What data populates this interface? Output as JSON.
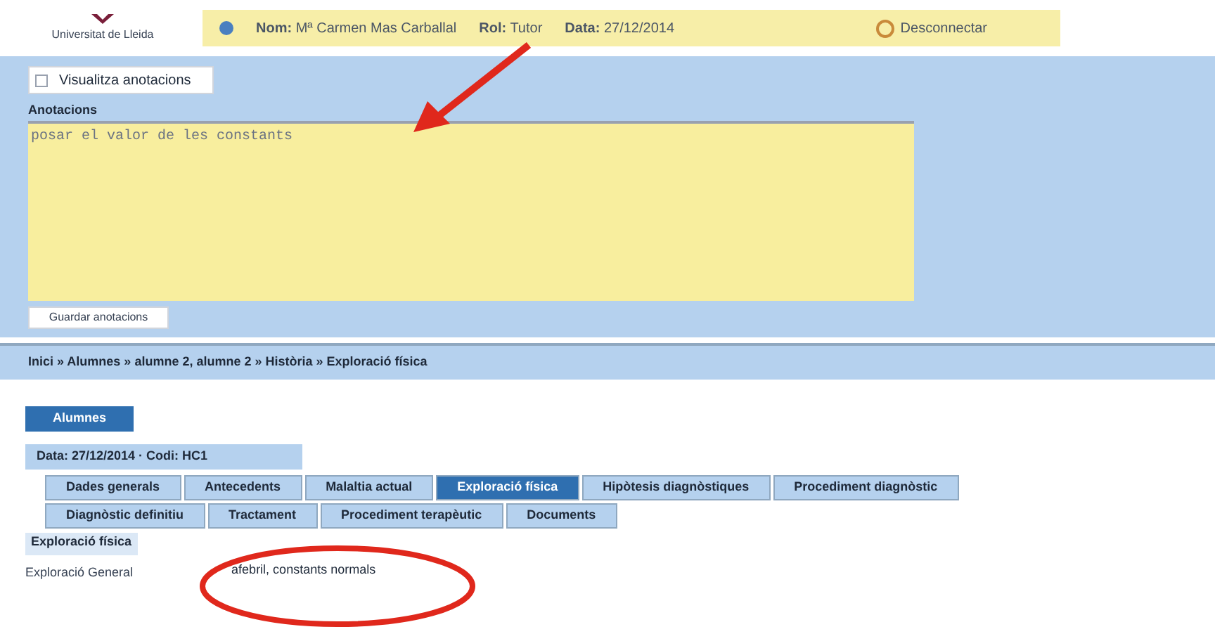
{
  "header": {
    "logo_text": "Universitat de Lleida",
    "user": "**Nom:** Mª Carmen Mas Carballal",
    "role": "**Rol:** Tutor",
    "date": "**Data:** 27/12/2014",
    "logout": "Desconnectar"
  },
  "annotations": {
    "toggle_button": "Visualitza anotacions",
    "checked": false,
    "label": "Anotacions",
    "text": "posar el valor de les constants",
    "save_button": "Guardar anotacions"
  },
  "breadcrumb": "Inici » Alumnes » alumne 2, alumne 2 » Història » Exploració física",
  "back_button": "Alumnes",
  "record_info": "Data: 27/12/2014 · Codi: HC1",
  "tabs": [
    [
      {
        "label": "Dades generals",
        "selected": false
      },
      {
        "label": "Antecedents",
        "selected": false
      },
      {
        "label": "Malaltia actual",
        "selected": false
      },
      {
        "label": "Exploració física",
        "selected": true
      },
      {
        "label": "Hipòtesis diagnòstiques",
        "selected": false
      },
      {
        "label": "Procediment diagnòstic",
        "selected": false
      }
    ],
    [
      {
        "label": "Diagnòstic definitiu",
        "selected": false
      },
      {
        "label": "Tractament",
        "selected": false
      },
      {
        "label": "Procediment terapèutic",
        "selected": false
      },
      {
        "label": "Documents",
        "selected": false
      }
    ]
  ],
  "section": {
    "title": "Exploració física",
    "fields": [
      {
        "label": "Exploració General",
        "value": "afebril, constants normals"
      }
    ]
  }
}
